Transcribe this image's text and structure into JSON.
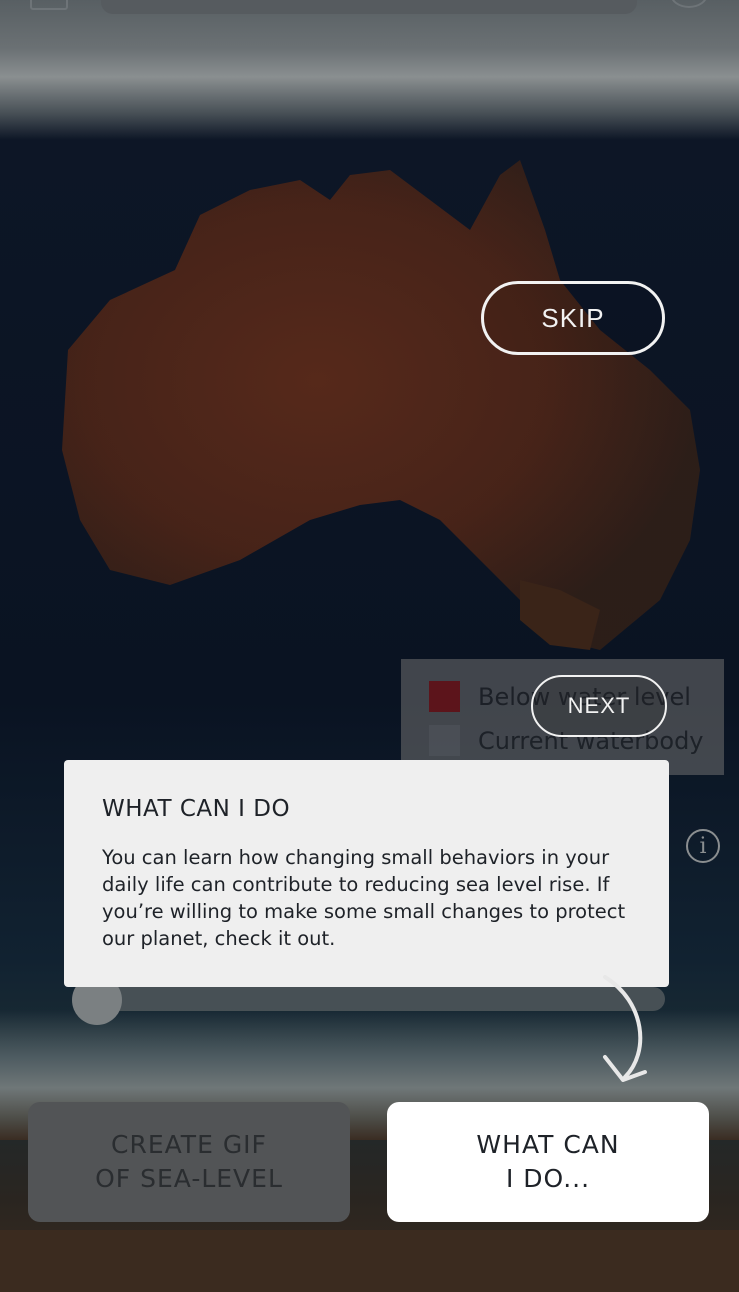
{
  "buttons": {
    "skip": "SKIP",
    "next": "NEXT",
    "create_gif": "CREATE GIF\nOF SEA-LEVEL",
    "what_can_i_do": "WHAT CAN\nI DO..."
  },
  "legend": {
    "items": [
      {
        "label": "Below water level",
        "color": "#a01616"
      },
      {
        "label": "Current waterbody",
        "color": "#7e7e7e"
      }
    ]
  },
  "tooltip": {
    "title": "WHAT CAN I DO",
    "body": "You can learn how changing small behaviors in your daily life can contribute to reducing sea level rise. If you’re willing to make some small changes to protect our planet, check it out."
  },
  "info_icon": "info-icon",
  "slider": {
    "value": 0
  }
}
